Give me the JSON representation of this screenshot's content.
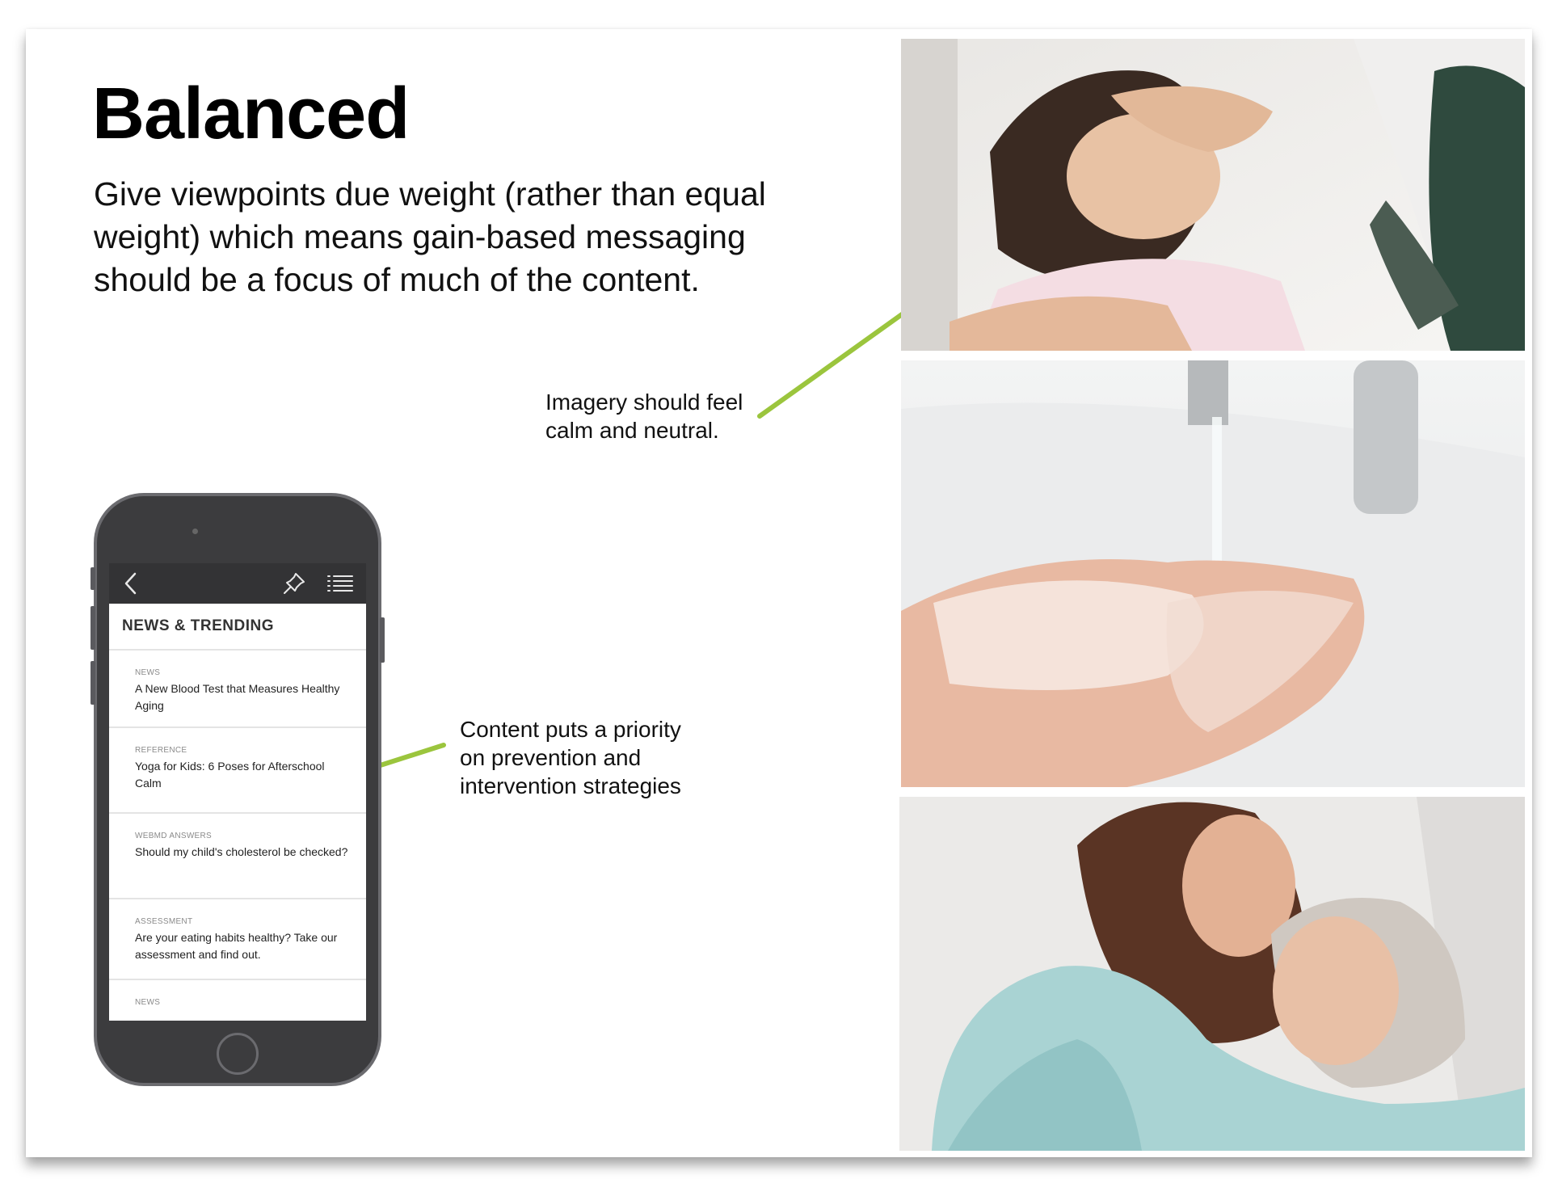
{
  "slide": {
    "title": "Balanced",
    "subtitle": "Give viewpoints due weight (rather than equal weight) which means gain-based messaging should be a focus of much of the content.",
    "accent_color": "#9bc53d"
  },
  "callouts": {
    "imagery": "Imagery should feel\ncalm and neutral.",
    "content": "Content puts a priority\non prevention and\nintervention strategies"
  },
  "phone": {
    "navbar": {
      "back_icon": "chevron-left-icon",
      "pin_icon": "pushpin-icon",
      "menu_icon": "list-menu-icon"
    },
    "section_title": "NEWS & TRENDING",
    "feed": [
      {
        "category": "NEWS",
        "title": "A New Blood Test that Measures Healthy Aging"
      },
      {
        "category": "REFERENCE",
        "title": "Yoga for Kids: 6 Poses for Afterschool Calm"
      },
      {
        "category": "WEBMD ANSWERS",
        "title": "Should my child's cholesterol be checked?"
      },
      {
        "category": "ASSESSMENT",
        "title": "Are your eating habits healthy? Take our assessment and find out."
      },
      {
        "category": "NEWS",
        "title": ""
      }
    ]
  }
}
